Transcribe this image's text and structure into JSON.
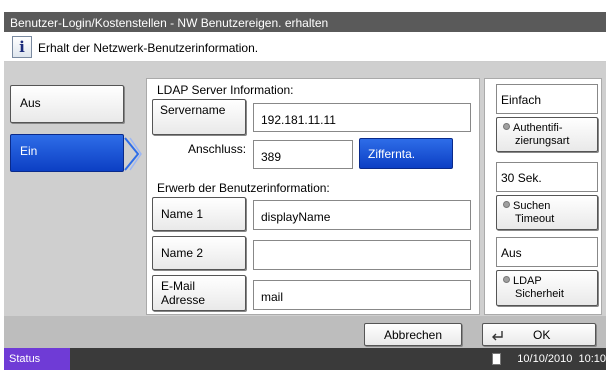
{
  "title": "Benutzer-Login/Kostenstellen - NW Benutzereigen. erhalten",
  "info": {
    "icon": "info-icon",
    "text": "Erhalt der Netzwerk-Benutzerinformation."
  },
  "left": {
    "off_label": "Aus",
    "on_label": "Ein"
  },
  "ldap_server": {
    "heading": "LDAP Server Information:",
    "servername_label": "Servername",
    "servername_value": "192.181.11.11",
    "port_label": "Anschluss:",
    "port_value": "389",
    "numkeys_label": "Ziffernta."
  },
  "user_info": {
    "heading": "Erwerb der Benutzerinformation:",
    "name1_label": "Name 1",
    "name1_value": "displayName",
    "name2_label": "Name 2",
    "name2_value": "",
    "email_label_1": "E-Mail",
    "email_label_2": "Adresse",
    "email_value": "mail"
  },
  "right": {
    "auth_value": "Einfach",
    "auth_button_1": "Authentifi-",
    "auth_button_2": "zierungsart",
    "timeout_value": "30",
    "timeout_unit": "Sek.",
    "timeout_button_1": "Suchen",
    "timeout_button_2": "Timeout",
    "security_value": "Aus",
    "security_button_1": "LDAP",
    "security_button_2": "Sicherheit"
  },
  "footer": {
    "cancel_label": "Abbrechen",
    "ok_label": "OK",
    "enter_icon": "enter-icon"
  },
  "status": {
    "label": "Status",
    "datetime": "10/10/2010  10:10",
    "icon": "memory-card-icon"
  }
}
